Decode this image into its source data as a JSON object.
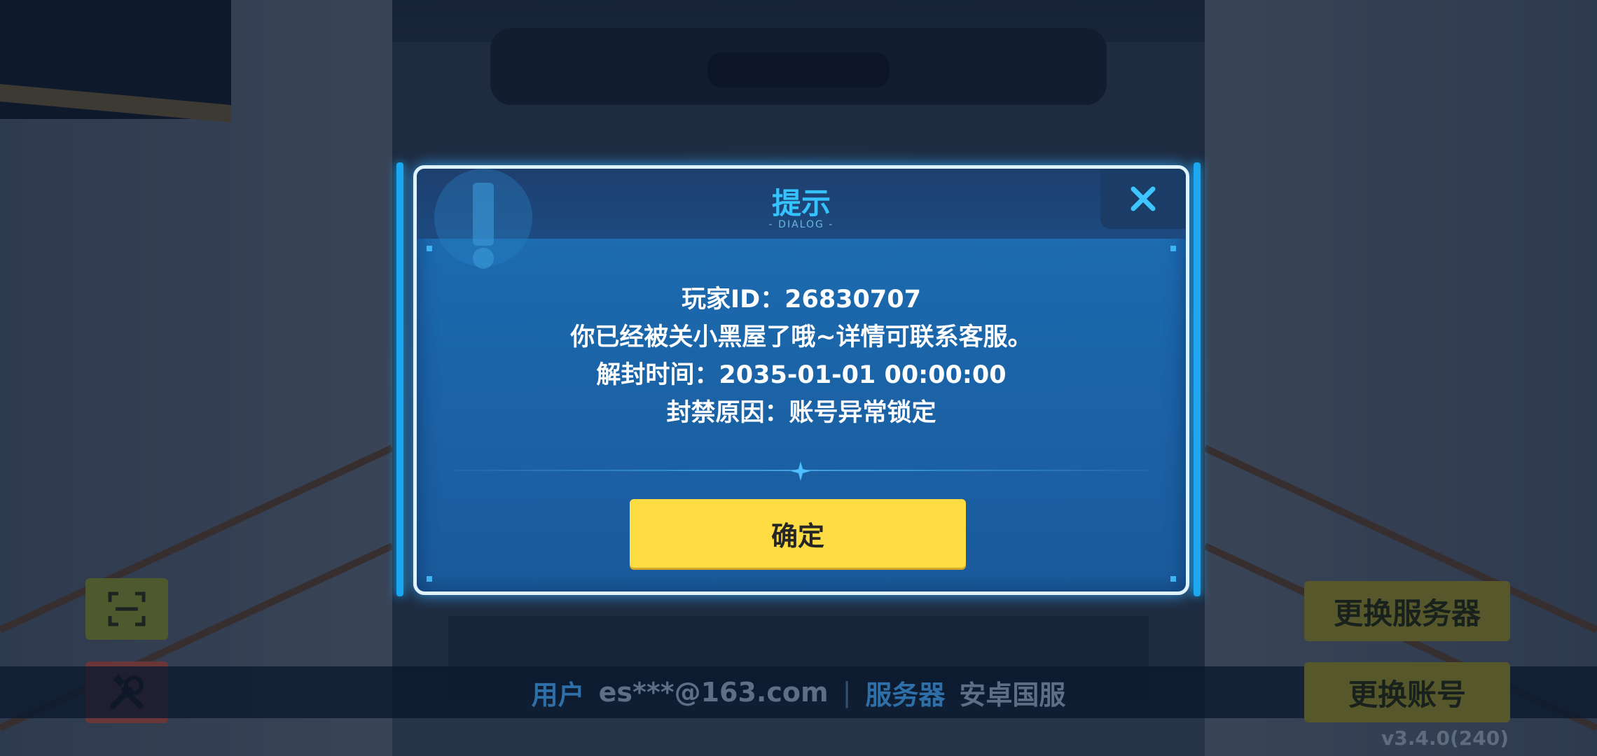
{
  "dialog": {
    "title": "提示",
    "subtitle": "- DIALOG -",
    "close_symbol": "✕",
    "lines": [
      "玩家ID：26830707",
      "你已经被关小黑屋了哦~详情可联系客服。",
      "解封时间：2035-01-01 00:00:00",
      "封禁原因：账号异常锁定"
    ],
    "confirm_label": "确定"
  },
  "info_bar": {
    "user_label": "用户",
    "user_value": "es***@163.com",
    "separator": "|",
    "server_label": "服务器",
    "server_value": "安卓国服"
  },
  "buttons": {
    "change_server": "更换服务器",
    "change_account": "更换账号"
  },
  "version": "v3.4.0(240)",
  "icons": {
    "scan": "scan-icon",
    "tools": "tools-icon",
    "close": "close-icon"
  },
  "colors": {
    "accent": "#34c3ff",
    "confirm": "#fedc43",
    "dialog_bg": "#1e6fb5"
  }
}
